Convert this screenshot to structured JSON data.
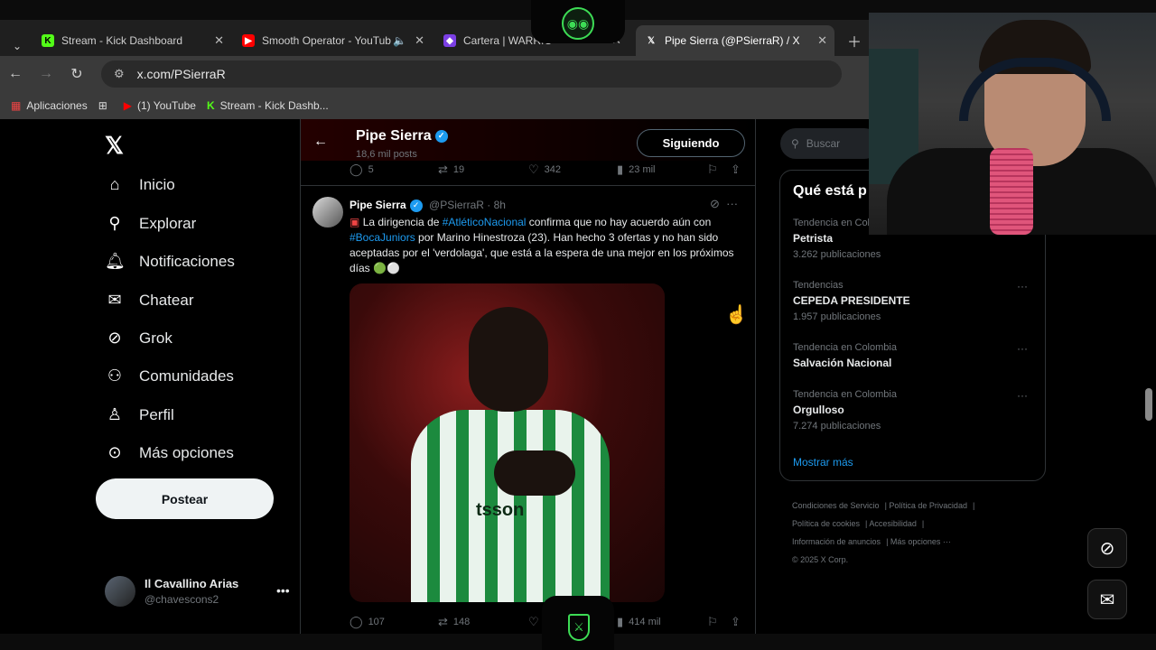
{
  "browser": {
    "tabs": [
      {
        "title": "Stream - Kick Dashboard",
        "icon": "kick-icon"
      },
      {
        "title": "Smooth Operator - YouTub",
        "icon": "youtube-icon"
      },
      {
        "title": "Cartera | WARRIO",
        "icon": "warrior-icon"
      },
      {
        "title": "Pipe Sierra (@PSierraR) / X",
        "icon": "x-icon"
      }
    ],
    "url": "x.com/PSierraR",
    "bookmarks": [
      "Aplicaciones",
      "(1) YouTube",
      "Stream - Kick Dashb..."
    ]
  },
  "nav": {
    "items": [
      "Inicio",
      "Explorar",
      "Notificaciones",
      "Chatear",
      "Grok",
      "Comunidades",
      "Perfil",
      "Más opciones"
    ],
    "post_label": "Postear",
    "account_name": "Il Cavallino Arias",
    "account_handle": "@chavescons2",
    "more_glyph": "•••"
  },
  "profile": {
    "name": "Pipe Sierra",
    "posts": "18,6 mil posts",
    "follow_label": "Siguiendo"
  },
  "prev_tweet": {
    "replies": "5",
    "reposts": "19",
    "likes": "342",
    "views": "23 mil"
  },
  "tweet": {
    "author": "Pipe Sierra",
    "handle_time": "@PSierraR · 8h",
    "text_a": "La dirigencia de ",
    "tag1": "#AtléticoNacional",
    "text_b": " confirma que no hay acuerdo aún con ",
    "tag2": "#BocaJuniors",
    "text_c": " por Marino Hinestroza (23). Han hecho 3 ofertas y no han sido aceptadas por el 'verdolaga', que está a la espera de una mejor en los próximos días 🟢⚪",
    "image_sponsor": "tsson",
    "replies": "107",
    "reposts": "148",
    "likes": "",
    "views": "414 mil"
  },
  "right": {
    "search_placeholder": "Buscar",
    "trends_title": "Qué está p",
    "trends": [
      {
        "category": "Tendencia en Colo",
        "name": "Petrista",
        "count": "3.262 publicaciones"
      },
      {
        "category": "Tendencias",
        "name": "CEPEDA PRESIDENTE",
        "count": "1.957 publicaciones"
      },
      {
        "category": "Tendencia en Colombia",
        "name": "Salvación Nacional",
        "count": ""
      },
      {
        "category": "Tendencia en Colombia",
        "name": "Orgulloso",
        "count": "7.274 publicaciones"
      }
    ],
    "show_more": "Mostrar más",
    "footer": [
      "Condiciones de Servicio",
      "Política de Privacidad",
      "Política de cookies",
      "Accesibilidad",
      "Información de anuncios",
      "Más opciones ···",
      "© 2025 X Corp."
    ]
  },
  "colors": {
    "accent": "#1d9bf0",
    "overlay_green": "#3ddc55"
  }
}
